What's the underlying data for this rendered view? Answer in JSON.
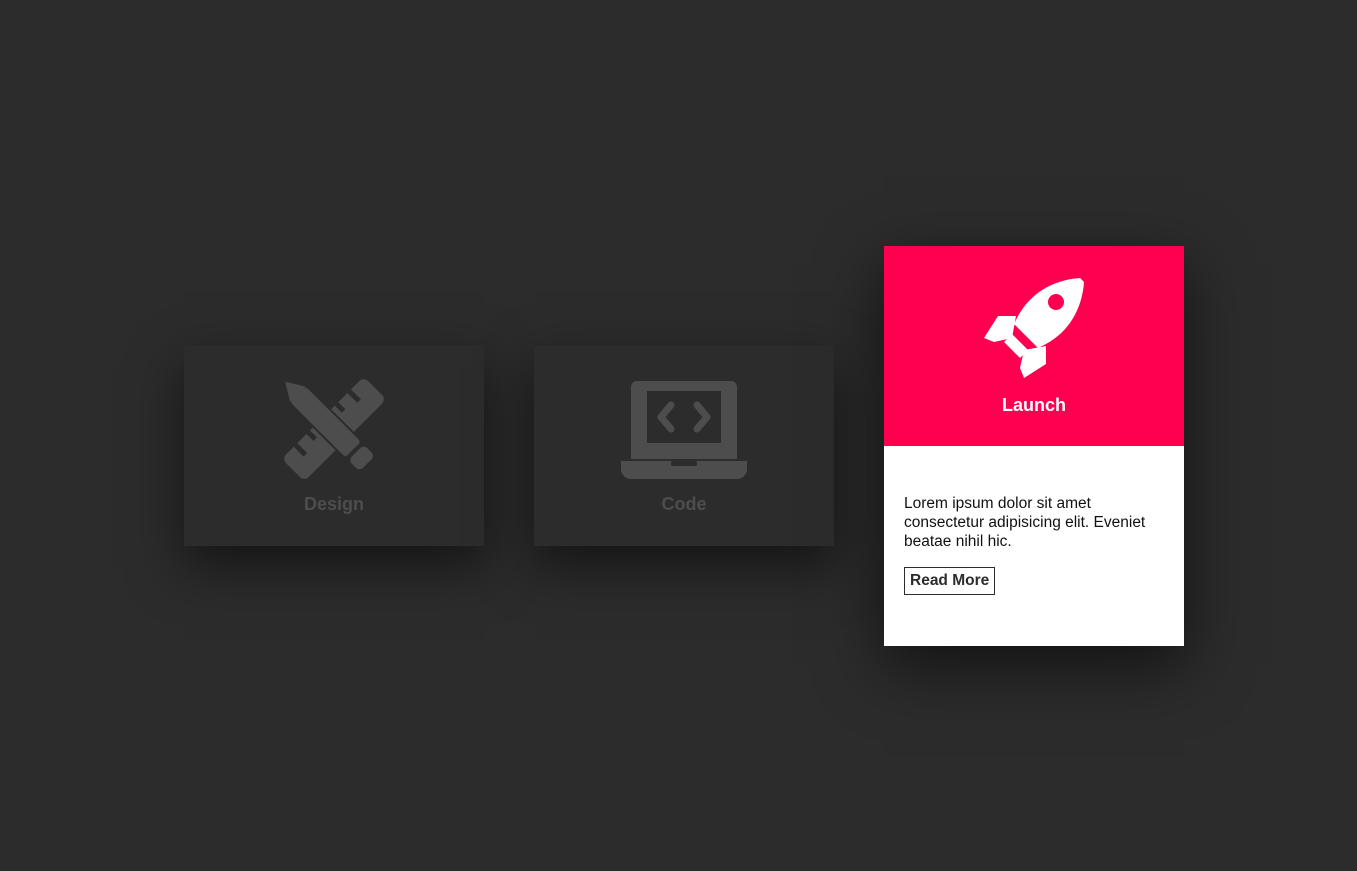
{
  "cards": [
    {
      "title": "Design",
      "icon": "pencil-ruler-icon",
      "state": "inactive"
    },
    {
      "title": "Code",
      "icon": "laptop-code-icon",
      "state": "inactive"
    },
    {
      "title": "Launch",
      "icon": "rocket-icon",
      "state": "active",
      "description": "Lorem ipsum dolor sit amet consectetur adipisicing elit. Eveniet beatae nihil hic.",
      "button_label": "Read More"
    }
  ],
  "colors": {
    "background": "#2c2c2c",
    "accent": "#ff0050",
    "inactive_icon": "#4d4d4d",
    "active_panel": "#ffffff"
  }
}
